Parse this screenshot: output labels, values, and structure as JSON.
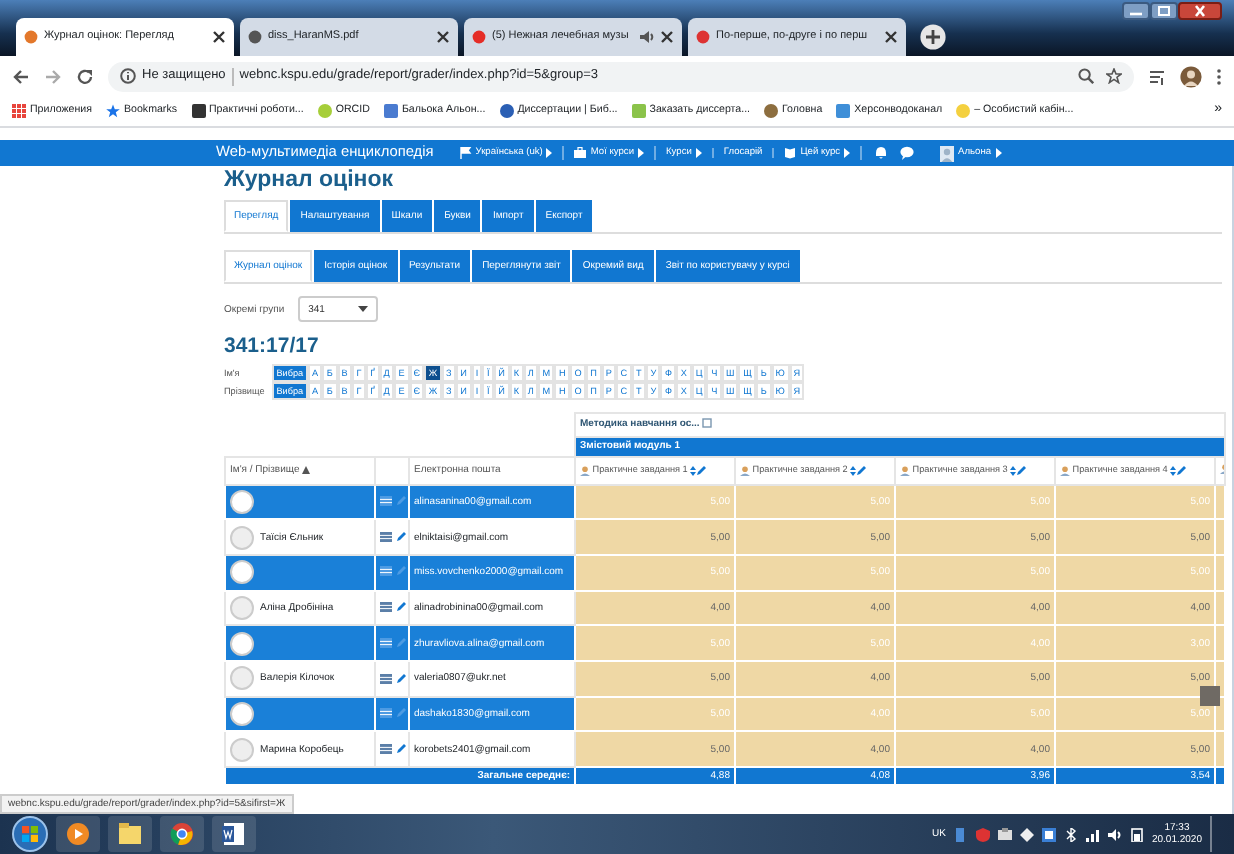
{
  "browser": {
    "tabs": [
      {
        "title": "Журнал оцінок: Перегляд",
        "selected": true,
        "audio": false
      },
      {
        "title": "diss_HaranMS.pdf",
        "selected": false,
        "audio": false
      },
      {
        "title": "(5) Нежная лечебная музы",
        "selected": false,
        "audio": true
      },
      {
        "title": "По-перше, по-друге і по перш",
        "selected": false,
        "audio": false
      }
    ],
    "security": "Не защищено",
    "url": "webnc.kspu.edu/grade/report/grader/index.php?id=5&group=3",
    "bookmarks": [
      {
        "label": "Приложения",
        "color": "#e8453c"
      },
      {
        "label": "Bookmarks",
        "color": "#1a73e8"
      },
      {
        "label": "Практичні роботи...",
        "color": "#333333"
      },
      {
        "label": "ORCID",
        "color": "#a6ce39"
      },
      {
        "label": "Бальока Альон...",
        "color": "#4a7bd0"
      },
      {
        "label": "Диссертации | Биб...",
        "color": "#2b5fb4"
      },
      {
        "label": "Заказать диссерта...",
        "color": "#8bc34a"
      },
      {
        "label": "Головна",
        "color": "#8d6e3f"
      },
      {
        "label": "Херсонводоканал",
        "color": "#3f8fd8"
      },
      {
        "label": "– Особистий кабін...",
        "color": "#f4d03f"
      }
    ],
    "bookmarks_more": "»"
  },
  "navbar": {
    "brand": "Web-мультимедіа енциклопедія",
    "items": [
      {
        "label": "Українська (uk)",
        "kind": "flag",
        "dropdown": true
      },
      {
        "label": "Мої курси",
        "kind": "briefcase",
        "dropdown": true
      },
      {
        "label": "Курси",
        "kind": "plain",
        "dropdown": true
      },
      {
        "label": "Глосарій",
        "kind": "plain",
        "dropdown": false
      },
      {
        "label": "Цей курс",
        "kind": "book",
        "dropdown": true
      }
    ],
    "user": "Альона"
  },
  "page": {
    "title": "Журнал оцінок",
    "tabs": [
      {
        "label": "Перегляд",
        "selected": true
      },
      {
        "label": "Налаштування",
        "selected": false
      },
      {
        "label": "Шкали",
        "selected": false
      },
      {
        "label": "Букви",
        "selected": false
      },
      {
        "label": "Імпорт",
        "selected": false
      },
      {
        "label": "Експорт",
        "selected": false
      }
    ],
    "subtabs": [
      {
        "label": "Журнал оцінок",
        "selected": true
      },
      {
        "label": "Історія оцінок",
        "selected": false
      },
      {
        "label": "Результати",
        "selected": false
      },
      {
        "label": "Переглянути звіт",
        "selected": false
      },
      {
        "label": "Окремий вид",
        "selected": false
      },
      {
        "label": "Звіт по користувачу у курсі",
        "selected": false
      }
    ],
    "group_filter": {
      "label": "Окремі групи",
      "value": "341"
    },
    "heading": "341:17/17",
    "initials": [
      {
        "label": "Ім'я",
        "letters": [
          {
            "label": "Вибра",
            "selected": true
          },
          {
            "label": "А",
            "selected": false
          },
          {
            "label": "Б",
            "selected": false
          },
          {
            "label": "В",
            "selected": false
          },
          {
            "label": "Г",
            "selected": false
          },
          {
            "label": "Ґ",
            "selected": false
          },
          {
            "label": "Д",
            "selected": false
          },
          {
            "label": "Е",
            "selected": false
          },
          {
            "label": "Є",
            "selected": false
          },
          {
            "label": "Ж",
            "selected": true
          },
          {
            "label": "З",
            "selected": false
          },
          {
            "label": "И",
            "selected": false
          },
          {
            "label": "І",
            "selected": false
          },
          {
            "label": "Ї",
            "selected": false
          },
          {
            "label": "Й",
            "selected": false
          },
          {
            "label": "К",
            "selected": false
          },
          {
            "label": "Л",
            "selected": false
          },
          {
            "label": "М",
            "selected": false
          },
          {
            "label": "Н",
            "selected": false
          },
          {
            "label": "О",
            "selected": false
          },
          {
            "label": "П",
            "selected": false
          },
          {
            "label": "Р",
            "selected": false
          },
          {
            "label": "С",
            "selected": false
          },
          {
            "label": "Т",
            "selected": false
          },
          {
            "label": "У",
            "selected": false
          },
          {
            "label": "Ф",
            "selected": false
          },
          {
            "label": "Х",
            "selected": false
          },
          {
            "label": "Ц",
            "selected": false
          },
          {
            "label": "Ч",
            "selected": false
          },
          {
            "label": "Ш",
            "selected": false
          },
          {
            "label": "Щ",
            "selected": false
          },
          {
            "label": "Ь",
            "selected": false
          },
          {
            "label": "Ю",
            "selected": false
          },
          {
            "label": "Я",
            "selected": false
          }
        ]
      },
      {
        "label": "Прізвище",
        "letters": [
          {
            "label": "Вибра",
            "selected": true
          },
          {
            "label": "А",
            "selected": false
          },
          {
            "label": "Б",
            "selected": false
          },
          {
            "label": "В",
            "selected": false
          },
          {
            "label": "Г",
            "selected": false
          },
          {
            "label": "Ґ",
            "selected": false
          },
          {
            "label": "Д",
            "selected": false
          },
          {
            "label": "Е",
            "selected": false
          },
          {
            "label": "Є",
            "selected": false
          },
          {
            "label": "Ж",
            "selected": false
          },
          {
            "label": "З",
            "selected": false
          },
          {
            "label": "И",
            "selected": false
          },
          {
            "label": "І",
            "selected": false
          },
          {
            "label": "Ї",
            "selected": false
          },
          {
            "label": "Й",
            "selected": false
          },
          {
            "label": "К",
            "selected": false
          },
          {
            "label": "Л",
            "selected": false
          },
          {
            "label": "М",
            "selected": false
          },
          {
            "label": "Н",
            "selected": false
          },
          {
            "label": "О",
            "selected": false
          },
          {
            "label": "П",
            "selected": false
          },
          {
            "label": "Р",
            "selected": false
          },
          {
            "label": "С",
            "selected": false
          },
          {
            "label": "Т",
            "selected": false
          },
          {
            "label": "У",
            "selected": false
          },
          {
            "label": "Ф",
            "selected": false
          },
          {
            "label": "Х",
            "selected": false
          },
          {
            "label": "Ц",
            "selected": false
          },
          {
            "label": "Ч",
            "selected": false
          },
          {
            "label": "Ш",
            "selected": false
          },
          {
            "label": "Щ",
            "selected": false
          },
          {
            "label": "Ь",
            "selected": false
          },
          {
            "label": "Ю",
            "selected": false
          },
          {
            "label": "Я",
            "selected": false
          }
        ]
      }
    ]
  },
  "grader": {
    "category": "Методика навчання ос...",
    "module": "Змістовий модуль 1",
    "name_column": "Ім'я / Прізвище",
    "email_column": "Електронна пошта",
    "grade_columns": [
      "Практичне завдання 1",
      "Практичне завдання 2",
      "Практичне завдання 3",
      "Практичне завдання 4"
    ],
    "rows": [
      {
        "selected": true,
        "email": "alinasanina00@gmail.com",
        "grades": [
          "5,00",
          "5,00",
          "5,00",
          "5,00"
        ]
      },
      {
        "selected": false,
        "name": "Таїсія Єльник",
        "email": "elniktaisi@gmail.com",
        "grades": [
          "5,00",
          "5,00",
          "5,00",
          "5,00"
        ]
      },
      {
        "selected": true,
        "email": "miss.vovchenko2000@gmail.com",
        "grades": [
          "5,00",
          "5,00",
          "5,00",
          "5,00"
        ]
      },
      {
        "selected": false,
        "name": "Аліна Дробініна",
        "email": "alinadrobinina00@gmail.com",
        "grades": [
          "4,00",
          "4,00",
          "4,00",
          "4,00"
        ]
      },
      {
        "selected": true,
        "email": "zhuravliova.alina@gmail.com",
        "grades": [
          "5,00",
          "5,00",
          "4,00",
          "3,00"
        ]
      },
      {
        "selected": false,
        "name": "Валерія Кілочок",
        "email": "valeria0807@ukr.net",
        "grades": [
          "5,00",
          "4,00",
          "5,00",
          "5,00"
        ]
      },
      {
        "selected": true,
        "email": "dashako1830@gmail.com",
        "grades": [
          "5,00",
          "4,00",
          "5,00",
          "5,00"
        ]
      },
      {
        "selected": false,
        "name": "Марина Коробець",
        "email": "korobets2401@gmail.com",
        "grades": [
          "5,00",
          "4,00",
          "4,00",
          "5,00"
        ]
      }
    ],
    "footer": {
      "label": "Загальне середнє:",
      "values": [
        "4,88",
        "4,08",
        "3,96",
        "3,54"
      ]
    }
  },
  "status_url": "webnc.kspu.edu/grade/report/grader/index.php?id=5&sifirst=Ж",
  "taskbar": {
    "language": "UK",
    "time": "17:33",
    "date": "20.01.2020"
  }
}
